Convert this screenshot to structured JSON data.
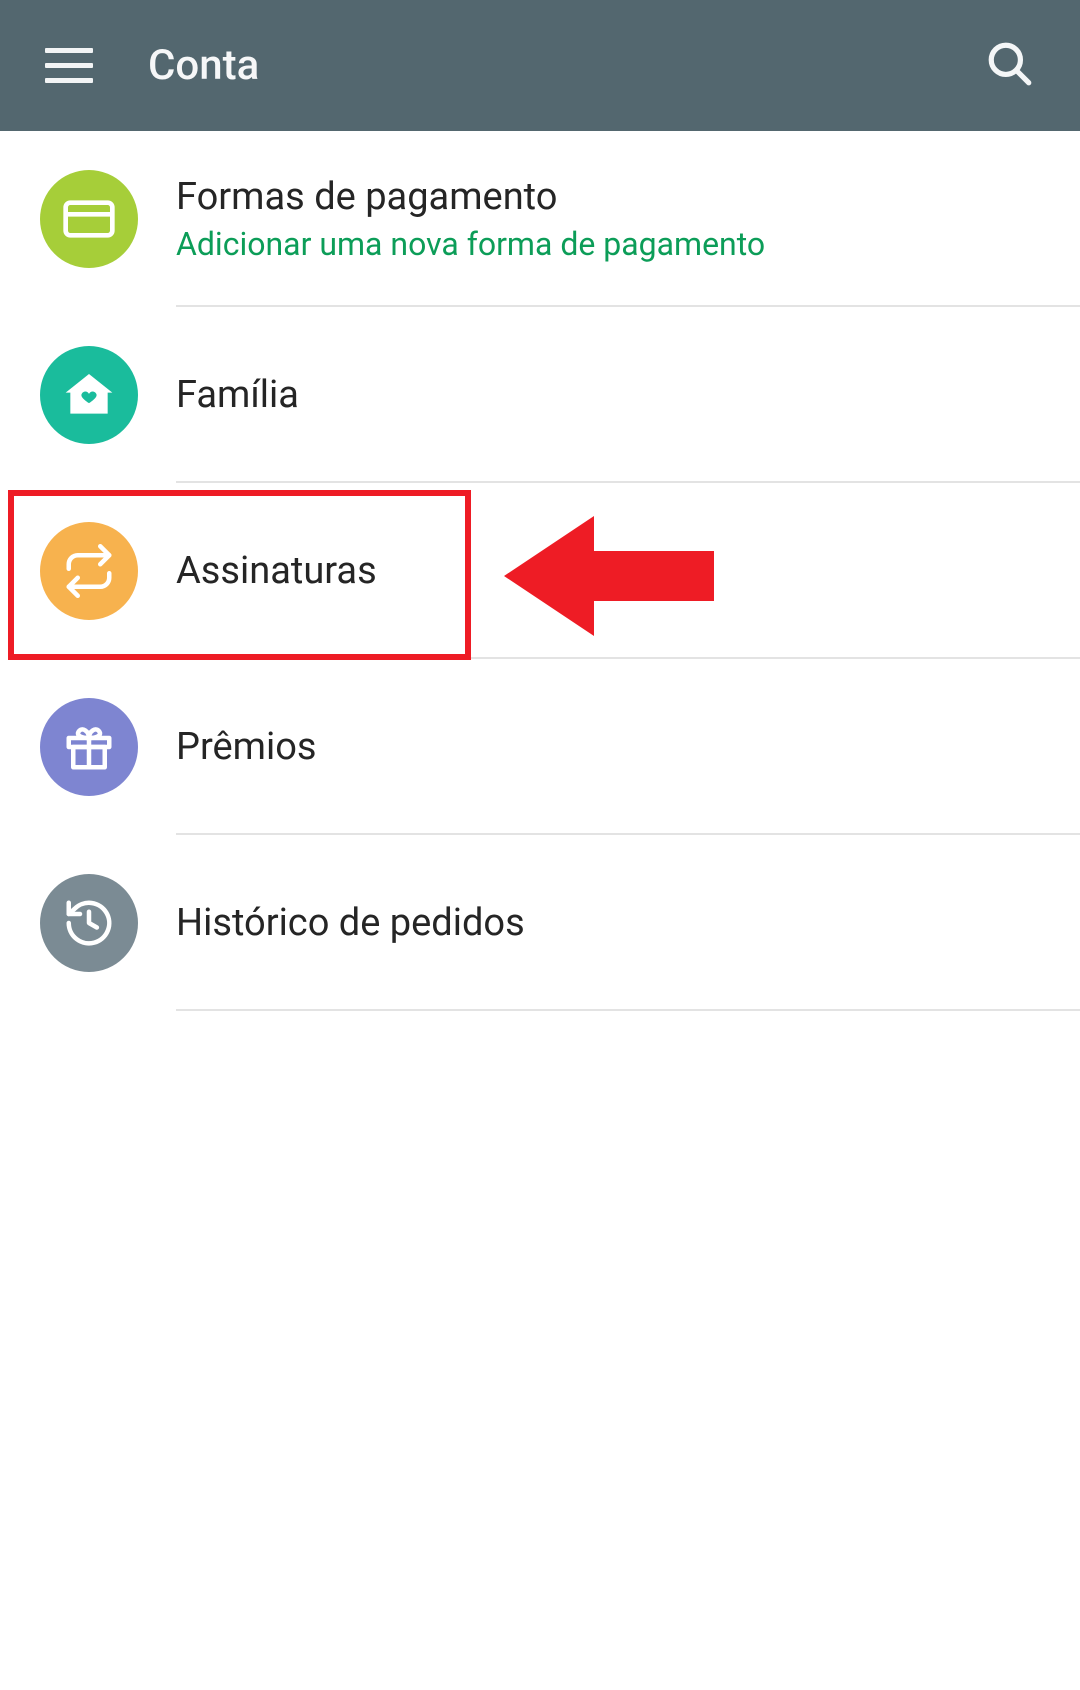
{
  "header": {
    "title": "Conta"
  },
  "items": [
    {
      "title": "Formas de pagamento",
      "subtitle": "Adicionar uma nova forma de pagamento",
      "icon": "credit-card-icon",
      "color": "#a6ce39"
    },
    {
      "title": "Família",
      "icon": "home-heart-icon",
      "color": "#1abc9c"
    },
    {
      "title": "Assinaturas",
      "icon": "repeat-icon",
      "color": "#f7b24e"
    },
    {
      "title": "Prêmios",
      "icon": "gift-icon",
      "color": "#7e85d1"
    },
    {
      "title": "Histórico de pedidos",
      "icon": "history-icon",
      "color": "#7b8b94"
    }
  ],
  "annotation": {
    "highlighted_item_index": 2,
    "arrow_color": "#ee1c25"
  }
}
